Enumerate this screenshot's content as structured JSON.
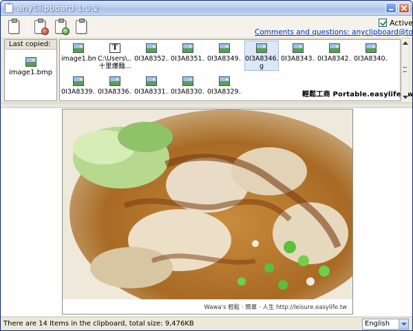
{
  "window": {
    "title": "anyClipboard 1.0.2"
  },
  "toolbar": {
    "buttons": [
      {
        "name": "paste",
        "icon": "clipboard-icon"
      },
      {
        "name": "remove",
        "icon": "clipboard-remove-icon"
      },
      {
        "name": "refresh",
        "icon": "clipboard-refresh-icon"
      },
      {
        "name": "copy",
        "icon": "clipboard-copy-icon"
      }
    ],
    "active_label": "Active",
    "active_checked": true,
    "contact_link": "Comments and questions: anyclipboard@toolilla.com"
  },
  "last_copied": {
    "title": "Last copied:",
    "item": "image1.bmp"
  },
  "items": [
    {
      "label": "image1.bmp",
      "type": "image"
    },
    {
      "label": "C:\\Users\\...",
      "label2": "十里爆麵...",
      "type": "text"
    },
    {
      "label": "0I3A8352....",
      "type": "image"
    },
    {
      "label": "0I3A8351....",
      "type": "image"
    },
    {
      "label": "0I3A8349....",
      "type": "image"
    },
    {
      "label": "0I3A8346.jp",
      "label2": "g",
      "type": "image",
      "selected": true
    },
    {
      "label": "0I3A8343....",
      "type": "image"
    },
    {
      "label": "0I3A8342....",
      "type": "image"
    },
    {
      "label": "0I3A8340....",
      "type": "image"
    },
    {
      "label": "0I3A8339....",
      "type": "image"
    },
    {
      "label": "0I3A8336....",
      "type": "image"
    },
    {
      "label": "0I3A8331....",
      "type": "image"
    },
    {
      "label": "0I3A8330....",
      "type": "image"
    },
    {
      "label": "0I3A8329....",
      "type": "image"
    }
  ],
  "watermark": {
    "text1": "輕鬆工商",
    "text2": "Portable.easylife.tw"
  },
  "preview": {
    "caption": "Wawa's 輕鬆 · 簡單 · 人生   http://leisure.easylife.tw"
  },
  "status": {
    "text": "There are 14 Items in the clipboard, total size: 9,476KB",
    "language": "English"
  }
}
